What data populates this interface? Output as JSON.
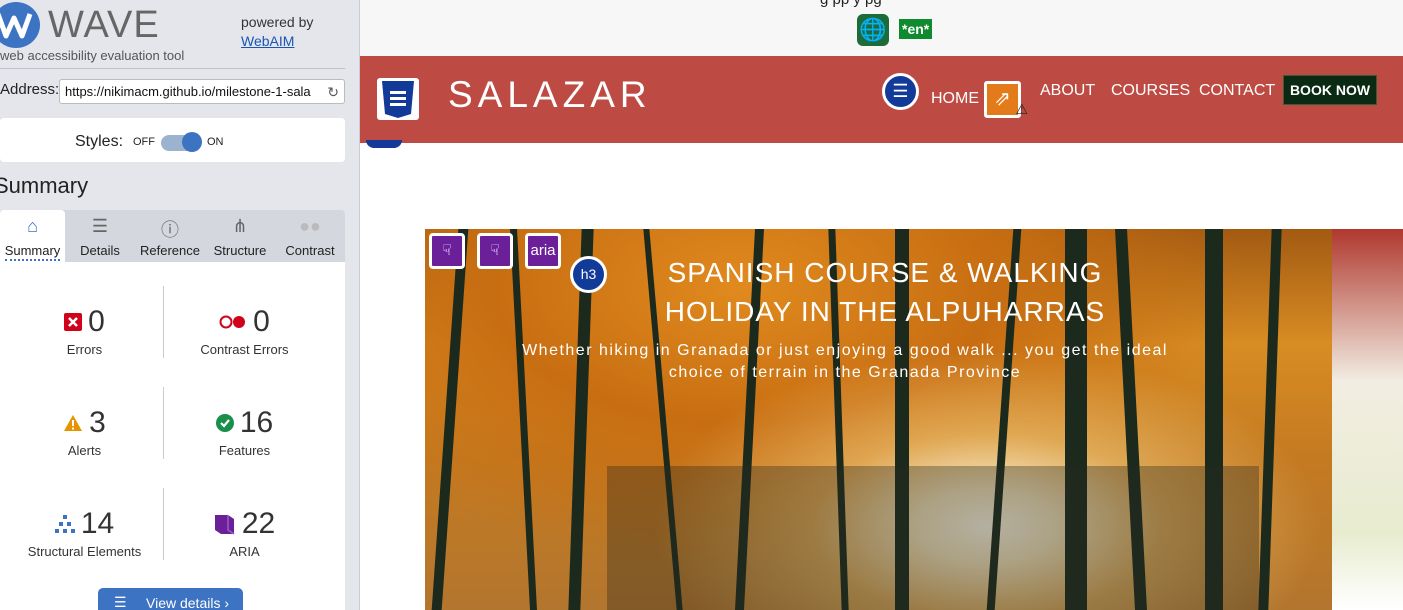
{
  "wave": {
    "logo_word": "WAVE",
    "tagline": "web accessibility evaluation tool",
    "powered_by": "powered by",
    "webaim_link": "WebAIM",
    "address_label": "Address:",
    "address_value": "https://nikimacm.github.io/milestone-1-sala",
    "styles_label": "Styles:",
    "styles_off": "OFF",
    "styles_on": "ON",
    "styles_state": "on",
    "summary_heading": "Summary",
    "tabs": [
      {
        "label": "Summary",
        "icon": "home-icon",
        "active": true
      },
      {
        "label": "Details",
        "icon": "list-icon",
        "active": false
      },
      {
        "label": "Reference",
        "icon": "info-icon",
        "active": false
      },
      {
        "label": "Structure",
        "icon": "sitemap-icon",
        "active": false
      },
      {
        "label": "Contrast",
        "icon": "contrast-icon",
        "active": false
      }
    ],
    "stats": {
      "errors": {
        "count": "0",
        "label": "Errors",
        "icon": "error-icon",
        "color": "#d0021b"
      },
      "contrast_errors": {
        "count": "0",
        "label": "Contrast Errors",
        "icon": "contrast-error-icon",
        "color": "#d0021b"
      },
      "alerts": {
        "count": "3",
        "label": "Alerts",
        "icon": "alert-icon",
        "color": "#e69500"
      },
      "features": {
        "count": "16",
        "label": "Features",
        "icon": "feature-icon",
        "color": "#1a8f4b"
      },
      "structural": {
        "count": "14",
        "label": "Structural Elements",
        "icon": "structure-icon",
        "color": "#3c73c2"
      },
      "aria": {
        "count": "22",
        "label": "ARIA",
        "icon": "aria-icon",
        "color": "#6b1f99"
      }
    },
    "view_details": "View details ›"
  },
  "site": {
    "top_cut_text": "g pp y         pg",
    "lang_badge": "*en*",
    "brand": "SALAZAR",
    "nav": [
      "HOME",
      "ABOUT",
      "COURSES",
      "CONTACT"
    ],
    "book_now": "BOOK NOW",
    "aria_tags": [
      "",
      "",
      "aria"
    ],
    "heading_badge": "h3",
    "hero_title": "SPANISH COURSE & WALKING HOLIDAY IN THE ALPUHARRAS",
    "hero_subtitle": "Whether hiking in Granada or just enjoying a good walk ... you get the ideal choice of terrain in the Granada Province",
    "colors": {
      "navbar": "#bd4b43",
      "wave_blue": "#3c73c2",
      "aria_purple": "#6b1f99"
    }
  }
}
